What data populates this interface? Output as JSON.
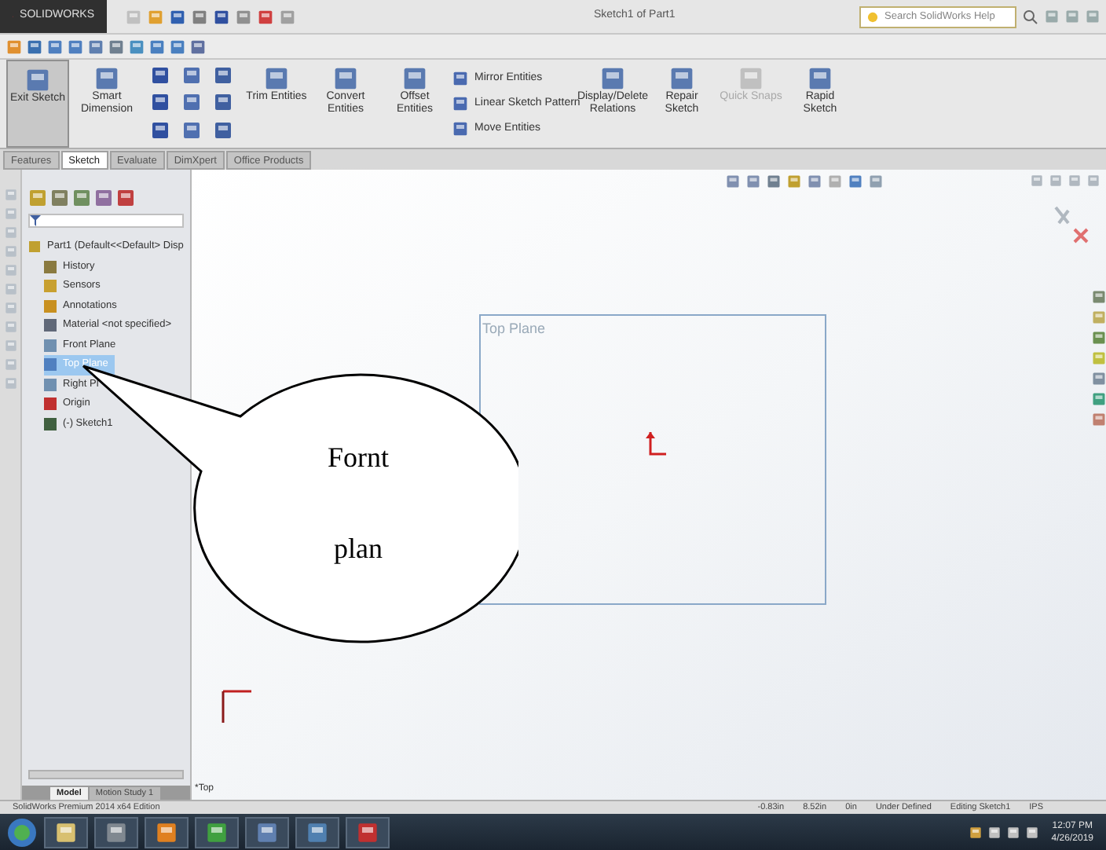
{
  "title_bar": {
    "logo": "SOLIDWORKS",
    "title": "Sketch1 of Part1",
    "search": {
      "placeholder": "Search SolidWorks Help"
    }
  },
  "ribbon": [
    {
      "kind": "large",
      "label": "Exit Sketch",
      "disabled": false,
      "pressed": true
    },
    {
      "kind": "large",
      "label": "Smart Dimension",
      "disabled": false,
      "pressed": false
    },
    {
      "kind": "grid"
    },
    {
      "kind": "large",
      "label": "Trim Entities",
      "disabled": false,
      "pressed": false
    },
    {
      "kind": "large",
      "label": "Convert Entities",
      "disabled": false,
      "pressed": false
    },
    {
      "kind": "large",
      "label": "Offset Entities",
      "disabled": false,
      "pressed": false
    },
    {
      "kind": "stack",
      "labels": [
        "Mirror Entities",
        "Linear Sketch Pattern",
        "Move Entities"
      ]
    },
    {
      "kind": "large",
      "label": "Display/Delete Relations",
      "disabled": false,
      "pressed": false
    },
    {
      "kind": "large",
      "label": "Repair Sketch",
      "disabled": false,
      "pressed": false
    },
    {
      "kind": "large",
      "label": "Quick Snaps",
      "disabled": true,
      "pressed": false
    },
    {
      "kind": "large",
      "label": "Rapid Sketch",
      "disabled": false,
      "pressed": false
    }
  ],
  "command_tabs": [
    {
      "label": "Features",
      "selected": false
    },
    {
      "label": "Sketch",
      "selected": true
    },
    {
      "label": "Evaluate",
      "selected": false
    },
    {
      "label": "DimXpert",
      "selected": false
    },
    {
      "label": "Office Products",
      "selected": false
    }
  ],
  "feature_tree": {
    "root": {
      "label": "Part1 (Default<<Default> Disp",
      "children": [
        {
          "label": "History",
          "selected": false,
          "color": "#8a7a40"
        },
        {
          "label": "Sensors",
          "selected": false,
          "color": "#c8a030"
        },
        {
          "label": "Annotations",
          "selected": false,
          "color": "#c89020"
        },
        {
          "label": "Material <not specified>",
          "selected": false,
          "color": "#606878"
        },
        {
          "label": "Front Plane",
          "selected": false,
          "color": "#7090b0"
        },
        {
          "label": "Top Plane",
          "selected": true,
          "color": "#5080c0"
        },
        {
          "label": "Right Pl",
          "selected": false,
          "color": "#7090b0"
        },
        {
          "label": "Origin",
          "selected": false,
          "color": "#c03030"
        },
        {
          "label": "(-) Sketch1",
          "selected": false,
          "color": "#406040"
        }
      ]
    }
  },
  "canvas": {
    "plane_label": "Top Plane",
    "view_label": "*Top"
  },
  "callout": {
    "text": "Fornt plan"
  },
  "bottom_tabs": [
    {
      "label": "Model",
      "selected": true
    },
    {
      "label": "Motion Study 1",
      "selected": false
    }
  ],
  "status_bar": {
    "app": "SolidWorks Premium 2014 x64 Edition",
    "readings": [
      "-0.83in",
      "8.52in",
      "0in",
      "Under Defined",
      "Editing Sketch1",
      "IPS"
    ]
  },
  "taskbar": {
    "time": "12:07 PM",
    "date": "4/26/2019"
  }
}
